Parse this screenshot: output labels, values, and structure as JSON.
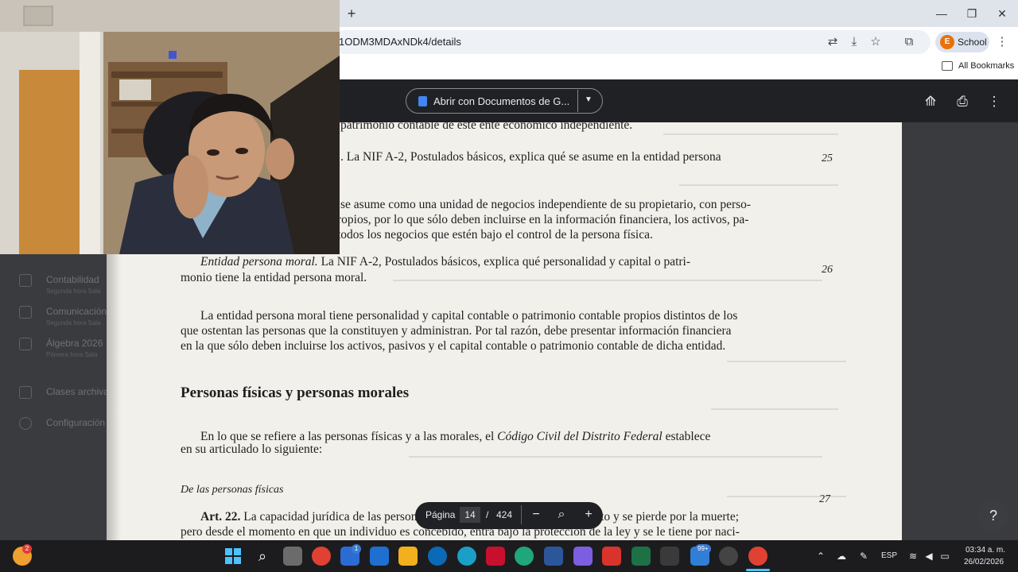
{
  "browser": {
    "url": "1ODM3MDAxNDk4/details",
    "profile_initial": "E",
    "profile_label": "School",
    "bookmarks_label": "All Bookmarks"
  },
  "viewer": {
    "open_with_label": "Abrir con Documentos de G..."
  },
  "sidebar": {
    "items": [
      {
        "label": "Contabilidad",
        "sub": "Segunda hora Sala"
      },
      {
        "label": "Comunicación",
        "sub": "Segunda hora Sala"
      },
      {
        "label": "Álgebra 2026",
        "sub": "Primera hora Sala"
      },
      {
        "label": "Clases archivadas",
        "sub": ""
      },
      {
        "label": "Configuración",
        "sub": ""
      }
    ]
  },
  "document": {
    "top_fragment": "patrimonio contable de este ente económico independiente.",
    "para1_tail": ". La NIF A-2, Postulados básicos, explica qué se asume en la entidad persona",
    "para2_l1": "se asume como una unidad de negocios independiente de su propietario, con perso-",
    "para2_l2": "ropios, por lo que sólo deben incluirse en la información financiera, los activos, pa-",
    "para2_l3": "todos los negocios que estén bajo el control de la persona física.",
    "moral_head": "Entidad persona moral.",
    "moral_l1": " La NIF A-2, Postulados básicos, explica qué personalidad y capital o patri-",
    "moral_l2": "monio tiene la entidad persona moral.",
    "para3_l1": "La entidad persona moral tiene personalidad y capital contable o patrimonio contable propios distintos de los",
    "para3_l2": "que ostentan las personas que la constituyen y administran. Por tal razón, debe presentar información financiera",
    "para3_l3": "en la que sólo deben incluirse los activos, pasivos y el capital contable o patrimonio contable de dicha entidad.",
    "section_title": "Personas físicas y personas morales",
    "para4_l1a": "En lo que se refiere a las personas físicas y a las morales, el ",
    "para4_l1b": "Código Civil del Distrito Federal",
    "para4_l1c": " establece",
    "para4_l2": "en su articulado lo siguiente:",
    "sub_title": "De las personas físicas",
    "art_head": "Art. 22.",
    "art_l1": " La capacidad jurídica de las personas físicas se adquiere por el nacimiento y se pierde por la muerte;",
    "art_l2": "pero desde el momento en que un individuo es concebido, entra bajo la protección de la ley y se le tiene por naci-",
    "margin_numbers": [
      "25",
      "26",
      "27"
    ]
  },
  "pager": {
    "label": "Página",
    "current": "14",
    "separator": "/",
    "total": "424"
  },
  "taskbar": {
    "weather_badge": "2",
    "outlook_badge": "1",
    "notif_badge": "99+",
    "lang": "ESP",
    "time": "03:34 a. m.",
    "date": "26/02/2026"
  },
  "colors": {
    "viewer_bg": "#202124",
    "page_bg": "#f2f0eb",
    "accent_blue": "#4285f4",
    "profile_orange": "#e8710a"
  }
}
